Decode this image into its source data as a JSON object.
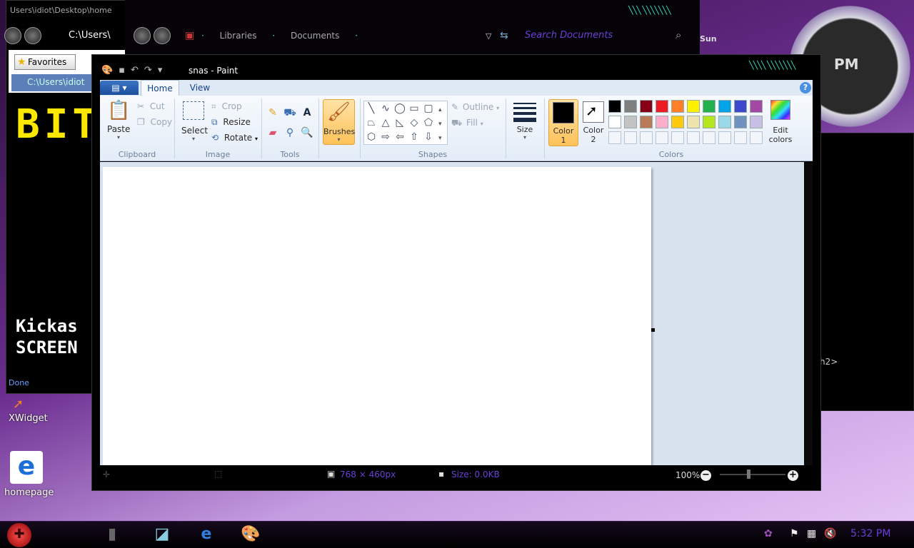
{
  "desktop": {
    "icons": [
      {
        "label": "XWidget",
        "icon": "xwidget-icon"
      },
      {
        "label": "homepage",
        "icon": "internet-explorer-icon"
      }
    ],
    "clock": {
      "period": "PM",
      "day": "Sun"
    }
  },
  "ie_window": {
    "title": "Users\\idiot\\Desktop\\home",
    "address": "C:\\Users\\",
    "favorites_label": "Favorites",
    "tab_label": "C:\\Users\\idiot",
    "page_heading": "BIT",
    "page_text_line1": "Kickas",
    "page_text_line2": "SCREEN",
    "status": "Done"
  },
  "explorer_window": {
    "breadcrumb": [
      "Libraries",
      "Documents"
    ],
    "search_placeholder": "Search Documents"
  },
  "right_window": {
    "text": "h2>"
  },
  "paint": {
    "title": "snas - Paint",
    "tabs": {
      "home": "Home",
      "view": "View"
    },
    "clipboard": {
      "paste": "Paste",
      "cut": "Cut",
      "copy": "Copy",
      "label": "Clipboard"
    },
    "image": {
      "select": "Select",
      "crop": "Crop",
      "resize": "Resize",
      "rotate": "Rotate",
      "label": "Image"
    },
    "tools": {
      "label": "Tools"
    },
    "brushes": {
      "label": "Brushes"
    },
    "shapes": {
      "outline": "Outline",
      "fill": "Fill",
      "label": "Shapes"
    },
    "size": {
      "label": "Size"
    },
    "colors": {
      "color1_label": "Color",
      "color1_num": "1",
      "color2_label": "Color",
      "color2_num": "2",
      "edit_label1": "Edit",
      "edit_label2": "colors",
      "label": "Colors",
      "color1_value": "#000000",
      "color2_value": "#ffffff",
      "palette_row1": [
        "#000000",
        "#7f7f7f",
        "#880015",
        "#ed1c24",
        "#ff7f27",
        "#fff200",
        "#22b14c",
        "#00a2e8",
        "#3f48cc",
        "#a349a4"
      ],
      "palette_row2": [
        "#ffffff",
        "#c3c3c3",
        "#b97a57",
        "#ffaec9",
        "#ffc90e",
        "#efe4b0",
        "#b5e61d",
        "#99d9ea",
        "#7092be",
        "#c8bfe7"
      ]
    },
    "status": {
      "dimensions": "768 × 460px",
      "size": "Size: 0.0KB",
      "zoom": "100%"
    }
  },
  "taskbar": {
    "clock": "5:32 PM"
  }
}
